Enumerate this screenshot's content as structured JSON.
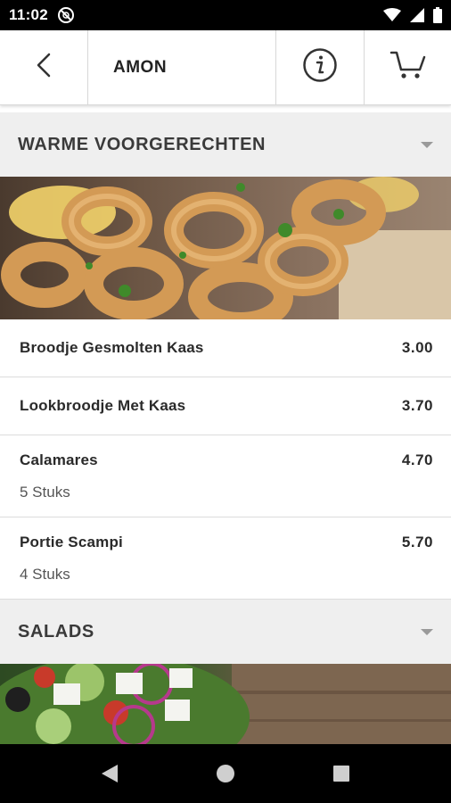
{
  "status_bar": {
    "time": "11:02",
    "icons": [
      "dnd-icon",
      "wifi-icon",
      "signal-icon",
      "battery-icon"
    ]
  },
  "header": {
    "title": "AMON",
    "icons": [
      "back-arrow-icon",
      "info-icon",
      "cart-icon"
    ]
  },
  "categories": [
    {
      "title": "WARME VOORGERECHTEN",
      "image": "calamari-photo",
      "items": [
        {
          "name": "Broodje Gesmolten Kaas",
          "price": "3.00",
          "subtitle": ""
        },
        {
          "name": "Lookbroodje Met Kaas",
          "price": "3.70",
          "subtitle": ""
        },
        {
          "name": "Calamares",
          "price": "4.70",
          "subtitle": "5 Stuks"
        },
        {
          "name": "Portie Scampi",
          "price": "5.70",
          "subtitle": "4 Stuks"
        }
      ]
    },
    {
      "title": "SALADS",
      "image": "salad-photo",
      "items": []
    }
  ],
  "nav_bar": {
    "icons": [
      "nav-back-icon",
      "nav-home-icon",
      "nav-recents-icon"
    ]
  },
  "colors": {
    "status_bar": "#000000",
    "category_bg": "#efefef",
    "text": "#222222"
  }
}
